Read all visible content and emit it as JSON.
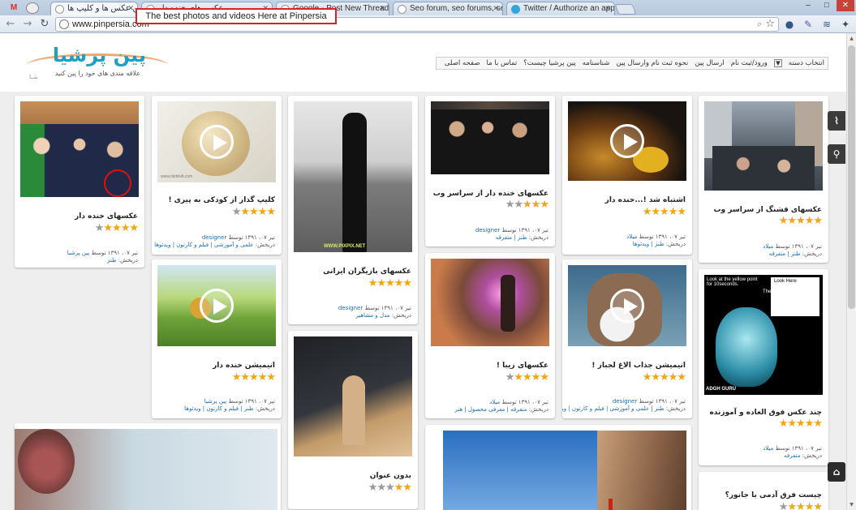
{
  "browser": {
    "tabs": [
      {
        "title": "بهترین عکس ها و کلیپ ها"
      },
      {
        "title": "عکس های خنده دار"
      },
      {
        "title": "Google - Post New Thread"
      },
      {
        "title": "Seo forum, seo forums, seo"
      },
      {
        "title": "Twitter / Authorize an app"
      }
    ],
    "tooltip": "The best photos and videos Here at Pinpersia",
    "url": "www.pinpersia.com"
  },
  "header": {
    "logo_text": "پین پرشیا",
    "logo_sub": "علاقه مندی های خود را پین کنید",
    "logo_beta": "بتــا",
    "nav": {
      "dropdown_label": "انتخاب دسته",
      "items": [
        "ورود/ثبت نام",
        "ارسال پین",
        "نحوه ثبت نام وارسال پین",
        "شناسنامه",
        "پین پرشیا چیست؟",
        "تماس با ما",
        "صفحه اصلی"
      ]
    }
  },
  "cards": [
    {
      "title": "عکسهای قشنگ از سراسر وب",
      "rating": 5,
      "date": "تیر ۰۷، ۱۳۹۱",
      "by": "توسط",
      "author": "میلاد",
      "cat_label": "دریخش:",
      "categories": "طنز | متفرقه"
    },
    {
      "title": "اشتباه شد !...خنده دار",
      "rating": 5,
      "date": "تیر ۰۷، ۱۳۹۱",
      "by": "توسط",
      "author": "میلاد",
      "cat_label": "دریخش:",
      "categories": "طنز | ویدئوها"
    },
    {
      "title": "عکسهای خنده دار از سراسر وب",
      "rating": 3,
      "date": "تیر ۰۷، ۱۳۹۱",
      "by": "توسط",
      "author": "designer",
      "cat_label": "دریخش:",
      "categories": "طنز | متفرقه"
    },
    {
      "title": "عکسهای بازیگران ایرانی",
      "rating": 5,
      "date": "تیر ۰۷، ۱۳۹۱",
      "by": "توسط",
      "author": "designer",
      "cat_label": "دریخش:",
      "categories": "مدل و مشاهیر"
    },
    {
      "title": "کلیپ گذار از کودکی به پیری !",
      "rating": 4,
      "date": "تیر ۰۷، ۱۳۹۱",
      "by": "توسط",
      "author": "designer",
      "cat_label": "دریخش:",
      "categories": "علمی و آموزشی | فیلم و کارتون | ویدئوها"
    },
    {
      "title": "عکسهای خنده دار",
      "rating": 4,
      "date": "تیر ۰۷، ۱۳۹۱",
      "by": "توسط",
      "author": "پین پرشیا",
      "cat_label": "دریخش:",
      "categories": "طنز"
    },
    {
      "title": "چند عکس فوق العاده و آموزنده",
      "rating": 5,
      "date": "تیر ۰۷، ۱۳۹۱",
      "by": "توسط",
      "author": "میلاد",
      "cat_label": "دریخش:",
      "categories": "متفرقه"
    },
    {
      "title": "انیمیشن جذاب الاغ لجباز !",
      "rating": 5,
      "date": "تیر ۰۷، ۱۳۹۱",
      "by": "توسط",
      "author": "designer",
      "cat_label": "دریخش:",
      "categories": "طنز | علمی و آموزشی | فیلم و کارتون | ویدئوها"
    },
    {
      "title": "عکسهای زیبا !",
      "rating": 4,
      "date": "تیر ۰۷، ۱۳۹۱",
      "by": "توسط",
      "author": "میلاد",
      "cat_label": "دریخش:",
      "categories": "متفرقه | معرفی محصول | هنر"
    },
    {
      "title": "بدون عنوان",
      "rating": 2
    },
    {
      "title": "انیمیشن خنده دار",
      "rating": 5,
      "date": "تیر ۰۷، ۱۳۹۱",
      "by": "توسط",
      "author": "پین پرشیا",
      "cat_label": "دریخش:",
      "categories": "طنز | فیلم و کارتون | ویدئوها"
    },
    {
      "title": "چیست فرق آدمی با جانور؟",
      "rating": 4
    }
  ],
  "thumb_texts": {
    "pixpix": "WWW.PIXPIX.NET",
    "animation": "www.nlorbolt.com",
    "look_left": "Look at the yellow point\nfor 10seconds.",
    "look_right": "Look Here",
    "then": "Then",
    "guru": "ADGH GURU"
  },
  "colors": {
    "link": "#1b6cb3",
    "star": "#f2a516",
    "logo": "#1f9fc4"
  }
}
